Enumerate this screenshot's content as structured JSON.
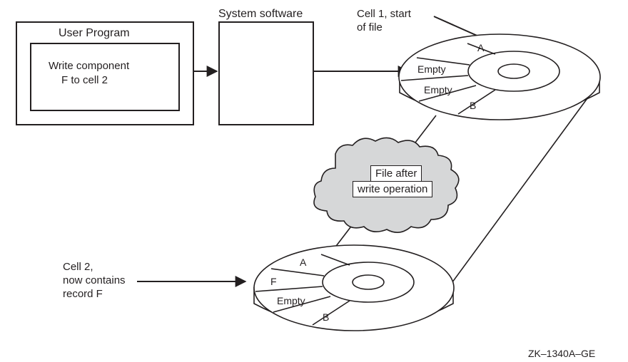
{
  "user_program": {
    "title": "User Program",
    "line1": "Write component",
    "line2": "F to cell 2"
  },
  "system_software": {
    "title": "System software"
  },
  "cell1": {
    "line1": "Cell 1, start",
    "line2": "of file"
  },
  "cell2": {
    "line1": "Cell 2,",
    "line2": "now contains",
    "line3": "record F"
  },
  "file_after": {
    "line1": "File after",
    "line2": "write operation"
  },
  "disk_top": {
    "a": "A",
    "c2": "Empty",
    "c3": "Empty",
    "b": "B"
  },
  "disk_bottom": {
    "a": "A",
    "f": "F",
    "c3": "Empty",
    "b": "B"
  },
  "figure_id": "ZK–1340A–GE"
}
